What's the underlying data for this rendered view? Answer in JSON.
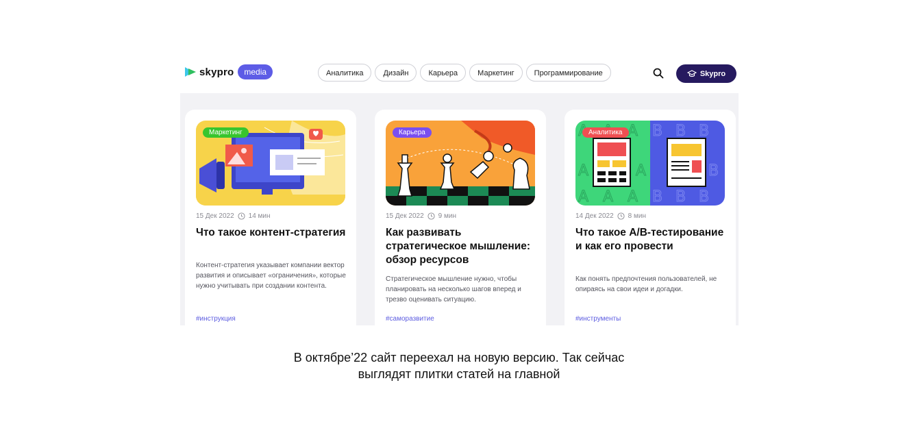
{
  "header": {
    "logo_text": "skypro",
    "logo_badge": "media",
    "nav": [
      "Аналитика",
      "Дизайн",
      "Карьера",
      "Маркетинг",
      "Программирование"
    ],
    "cta_label": "Skypro"
  },
  "colors": {
    "accent": "#5d5ce6",
    "cta": "#261a5f",
    "tag_marketing": "#38c52e",
    "tag_career": "#7a4ff0",
    "tag_analytics": "#ef4f52"
  },
  "cards": [
    {
      "tag": "Маркетинг",
      "date": "15 Дек 2022",
      "read_time": "14 мин",
      "title": "Что такое контент-стратегия",
      "description": "Контент-стратегия указывает компании вектор развития и описывает «ограничения», которые нужно учитывать при создании контента.",
      "hashtag": "#инструкция"
    },
    {
      "tag": "Карьера",
      "date": "15 Дек 2022",
      "read_time": "9 мин",
      "title": "Как развивать стратегическое мышление: обзор ресурсов",
      "description": "Стратегическое мышление нужно, чтобы планировать на несколько шагов вперед и трезво оценивать ситуацию.",
      "hashtag": "#саморазвитие"
    },
    {
      "tag": "Аналитика",
      "date": "14 Дек 2022",
      "read_time": "8 мин",
      "title": "Что такое A/B-тестирование и как его провести",
      "description": "Как понять предпочтения пользователей, не опираясь на свои идеи и догадки.",
      "hashtag": "#инструменты",
      "illustration_letters": [
        "A",
        "B"
      ]
    }
  ],
  "caption": {
    "line1": "В октябре’22 сайт переехал на новую версию. Так сейчас",
    "line2": "выглядят плитки статей на главной"
  }
}
